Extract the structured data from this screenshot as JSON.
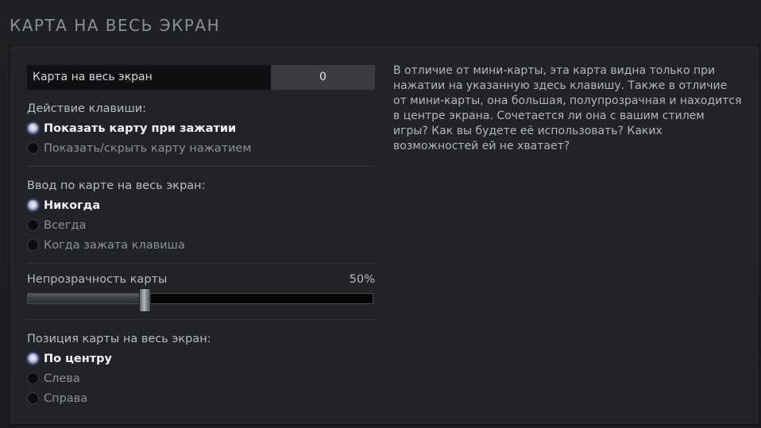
{
  "header": {
    "title": "КАРТА НА ВЕСЬ ЭКРАН"
  },
  "keybind": {
    "label": "Карта на весь экран",
    "key": "0"
  },
  "key_action": {
    "label": "Действие клавиши:",
    "options": [
      {
        "label": "Показать карту при зажатии",
        "selected": true
      },
      {
        "label": "Показать/скрыть карту нажатием",
        "selected": false
      }
    ]
  },
  "map_input": {
    "label": "Ввод по карте на весь экран:",
    "options": [
      {
        "label": "Никогда",
        "selected": true
      },
      {
        "label": "Всегда",
        "selected": false
      },
      {
        "label": "Когда зажата клавиша",
        "selected": false
      }
    ]
  },
  "opacity": {
    "label": "Непрозрачность карты",
    "value_text": "50%",
    "value": 0.34
  },
  "position": {
    "label": "Позиция карты на весь экран:",
    "options": [
      {
        "label": "По центру",
        "selected": true
      },
      {
        "label": "Слева",
        "selected": false
      },
      {
        "label": "Справа",
        "selected": false
      }
    ]
  },
  "description": {
    "text": "В отличие от мини-карты, эта карта видна только при нажатии на указанную здесь клавишу. Также в отличие от мини-карты, она большая, полупрозрачная и находится в центре экрана. Сочетается ли она с вашим стилем игры? Как вы будете её использовать? Каких возможностей ей не хватает?"
  }
}
